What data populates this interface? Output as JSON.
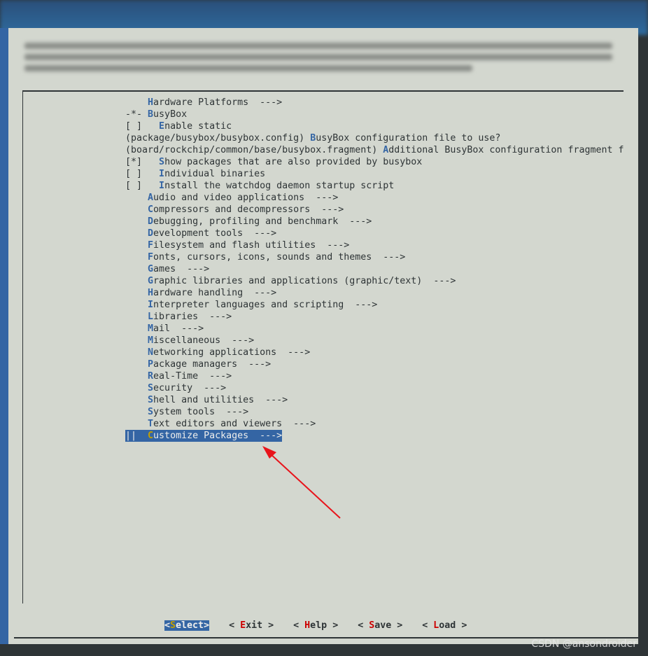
{
  "menu_rows": [
    {
      "pre": "    ",
      "hot": "H",
      "post": "ardware Platforms  --->"
    },
    {
      "pre": "-*- ",
      "hot": "B",
      "post": "usyBox"
    },
    {
      "pre": "[ ]   ",
      "hot": "E",
      "post": "nable static"
    },
    {
      "pre": "(package/busybox/busybox.config) ",
      "hot": "B",
      "post": "usyBox configuration file to use?"
    },
    {
      "pre": "(board/rockchip/common/base/busybox.fragment) ",
      "hot": "A",
      "post": "dditional BusyBox configuration fragment f"
    },
    {
      "pre": "[*]   ",
      "hot": "S",
      "post": "how packages that are also provided by busybox"
    },
    {
      "pre": "[ ]   ",
      "hot": "I",
      "post": "ndividual binaries"
    },
    {
      "pre": "[ ]   ",
      "hot": "I",
      "post": "nstall the watchdog daemon startup script"
    },
    {
      "pre": "    ",
      "hot": "A",
      "post": "udio and video applications  --->"
    },
    {
      "pre": "    ",
      "hot": "C",
      "post": "ompressors and decompressors  --->"
    },
    {
      "pre": "    ",
      "hot": "D",
      "post": "ebugging, profiling and benchmark  --->"
    },
    {
      "pre": "    ",
      "hot": "D",
      "post": "evelopment tools  --->"
    },
    {
      "pre": "    ",
      "hot": "F",
      "post": "ilesystem and flash utilities  --->"
    },
    {
      "pre": "    ",
      "hot": "F",
      "post": "onts, cursors, icons, sounds and themes  --->"
    },
    {
      "pre": "    ",
      "hot": "G",
      "post": "ames  --->"
    },
    {
      "pre": "    ",
      "hot": "G",
      "post": "raphic libraries and applications (graphic/text)  --->"
    },
    {
      "pre": "    ",
      "hot": "H",
      "post": "ardware handling  --->"
    },
    {
      "pre": "    ",
      "hot": "I",
      "post": "nterpreter languages and scripting  --->"
    },
    {
      "pre": "    ",
      "hot": "L",
      "post": "ibraries  --->"
    },
    {
      "pre": "    ",
      "hot": "M",
      "post": "ail  --->"
    },
    {
      "pre": "    ",
      "hot": "M",
      "post": "iscellaneous  --->"
    },
    {
      "pre": "    ",
      "hot": "N",
      "post": "etworking applications  --->"
    },
    {
      "pre": "    ",
      "hot": "P",
      "post": "ackage managers  --->"
    },
    {
      "pre": "    ",
      "hot": "R",
      "post": "eal-Time  --->"
    },
    {
      "pre": "    ",
      "hot": "S",
      "post": "ecurity  --->"
    },
    {
      "pre": "    ",
      "hot": "S",
      "post": "hell and utilities  --->"
    },
    {
      "pre": "    ",
      "hot": "S",
      "post": "ystem tools  --->"
    },
    {
      "pre": "    ",
      "hot": "T",
      "post": "ext editors and viewers  --->"
    },
    {
      "pre": "||  ",
      "hot": "C",
      "post": "ustomize Packages  --->",
      "selected": true
    }
  ],
  "buttons": [
    {
      "pre": "<",
      "hot": "S",
      "post": "elect>",
      "active": true
    },
    {
      "pre": "< ",
      "hot": "E",
      "post": "xit >"
    },
    {
      "pre": "< ",
      "hot": "H",
      "post": "elp >"
    },
    {
      "pre": "< ",
      "hot": "S",
      "post": "ave >"
    },
    {
      "pre": "< ",
      "hot": "L",
      "post": "oad >"
    }
  ],
  "watermark": "CSDN @ansondroider",
  "colors": {
    "hotkey": "#3465a4",
    "selection": "#3465a4",
    "button_hotkey": "#cc0000",
    "annotation_arrow": "#e8141b"
  }
}
